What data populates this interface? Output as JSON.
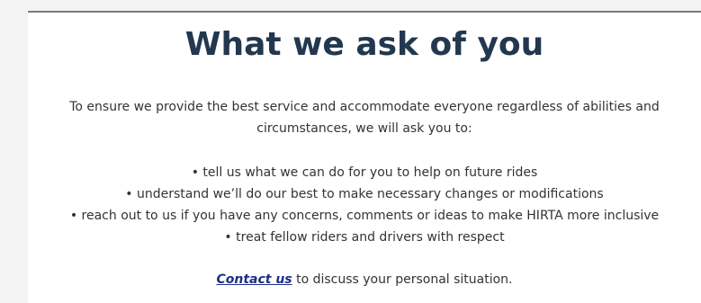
{
  "section": {
    "heading": "What we ask of you",
    "intro_line1": "To ensure we provide the best service and accommodate everyone regardless of abilities and",
    "intro_line2": "circumstances, we will ask you to:",
    "bullets": [
      "tell us what we can do for you to help on future rides",
      "understand we’ll do our best to make necessary changes or modifications",
      "reach out to us if you have any concerns, comments or ideas to make HIRTA more inclusive",
      "treat fellow riders and drivers with respect"
    ],
    "contact_link": "Contact us",
    "contact_rest": " to discuss your personal situation."
  },
  "colors": {
    "heading": "#22384f",
    "body_text": "#333333",
    "link": "#1a2f8a",
    "background": "#f3f3f4"
  }
}
